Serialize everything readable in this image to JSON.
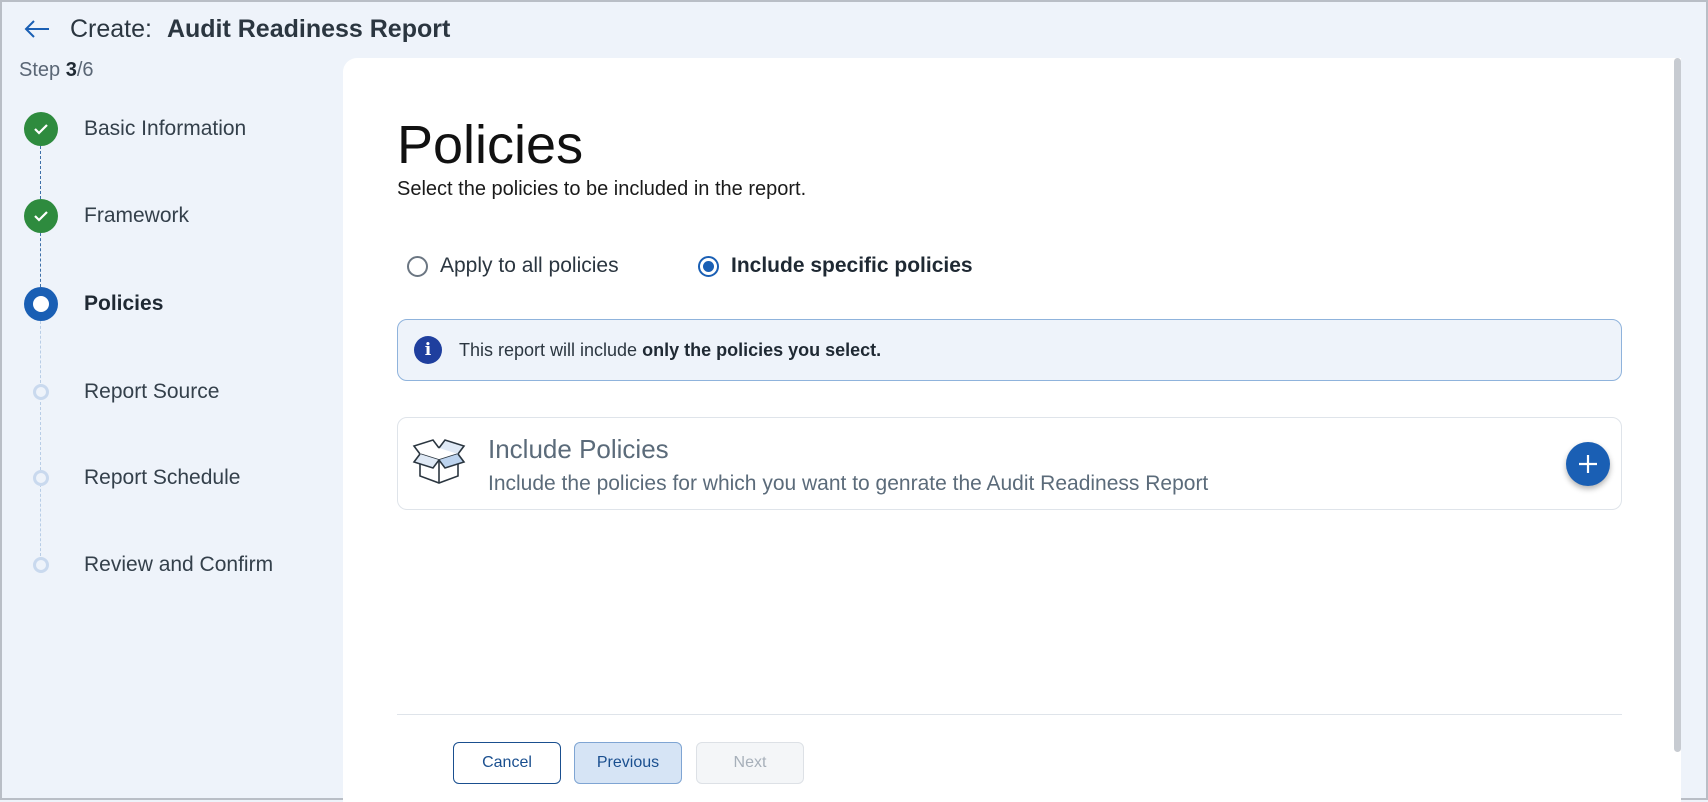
{
  "header": {
    "prefix": "Create:",
    "title": "Audit Readiness Report",
    "back_icon": "arrow-left-icon"
  },
  "stepper": {
    "step_label": "Step",
    "current": "3",
    "total": "/6",
    "steps": [
      {
        "label": "Basic Information",
        "state": "done"
      },
      {
        "label": "Framework",
        "state": "done"
      },
      {
        "label": "Policies",
        "state": "active"
      },
      {
        "label": "Report Source",
        "state": "pending"
      },
      {
        "label": "Report Schedule",
        "state": "pending"
      },
      {
        "label": "Review and Confirm",
        "state": "pending"
      }
    ]
  },
  "main": {
    "title": "Policies",
    "subtitle": "Select the policies to be included in the report.",
    "radio_options": [
      {
        "label": "Apply to all policies",
        "selected": false
      },
      {
        "label": "Include specific policies",
        "selected": true
      }
    ],
    "info": {
      "text_prefix": "This report will include ",
      "text_bold": "only the policies you select."
    },
    "include_card": {
      "title": "Include Policies",
      "description": "Include the policies for which you want to genrate the Audit Readiness Report",
      "icon": "open-box-icon",
      "add_icon": "plus-icon"
    }
  },
  "footer": {
    "cancel_label": "Cancel",
    "previous_label": "Previous",
    "next_label": "Next"
  },
  "colors": {
    "accent": "#1a5fb4",
    "success": "#2e8b3e",
    "background": "#eef3fa"
  }
}
